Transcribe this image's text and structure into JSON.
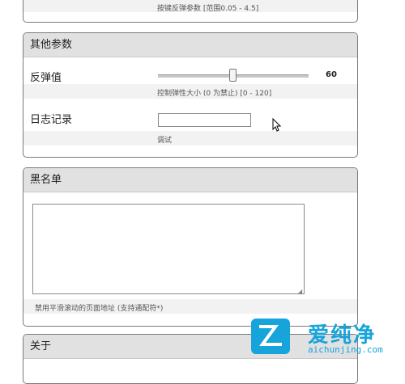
{
  "top_panel": {
    "hint": "按键反弹参数 [范围0.05 - 4.5]"
  },
  "other_panel": {
    "title": "其他参数",
    "bounce": {
      "label": "反弹值",
      "value": "60",
      "level_fraction": 0.5,
      "hint": "控制弹性大小 (0 为禁止) [0 - 120]"
    },
    "log": {
      "label": "日志记录",
      "input_value": "",
      "hint": "调试"
    }
  },
  "blacklist_panel": {
    "title": "黑名单",
    "textarea_value": "",
    "hint": "禁用平滑滚动的页面地址 (支持通配符*)"
  },
  "about_panel": {
    "title": "关于"
  },
  "watermark": {
    "text": "爱纯净",
    "url": "aichunjing.com"
  }
}
